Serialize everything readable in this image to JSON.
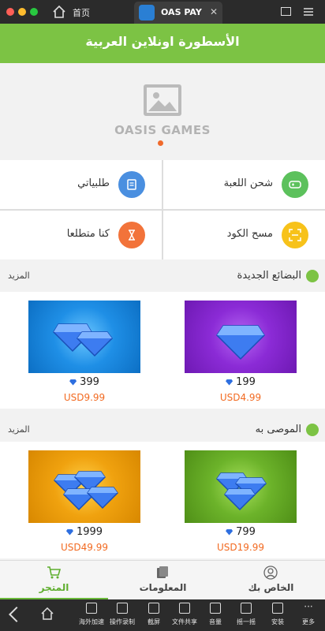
{
  "emulator": {
    "home_tab": "首页",
    "app_tab": "OAS PAY",
    "tools": [
      "海外加速",
      "操作录制",
      "截屏",
      "文件共享",
      "音量",
      "摇一摇",
      "安装",
      "更多"
    ]
  },
  "app": {
    "title": "الأسطورة اونلاين العربية"
  },
  "banner": {
    "logo_text": "OASIS GAMES"
  },
  "menu": [
    {
      "label": "شحن اللعبة",
      "color": "#5cc15c",
      "icon": "gamepad-icon"
    },
    {
      "label": "طلبياتي",
      "color": "#4a8fe0",
      "icon": "orders-icon"
    },
    {
      "label": "مسح الكود",
      "color": "#f7c21a",
      "icon": "scan-icon"
    },
    {
      "label": "كنا متطلعا",
      "color": "#f2733a",
      "icon": "hourglass-icon"
    }
  ],
  "sections": [
    {
      "title": "البضائع الجديدة",
      "more": "المزيد",
      "products": [
        {
          "gems": "199",
          "price": "USD4.99",
          "bg": "#8b2bd6"
        },
        {
          "gems": "399",
          "price": "USD9.99",
          "bg": "#1f8fe6"
        }
      ]
    },
    {
      "title": "الموصى به",
      "more": "المزيد",
      "products": [
        {
          "gems": "799",
          "price": "USD19.99",
          "bg": "#6cb32a"
        },
        {
          "gems": "1999",
          "price": "USD49.99",
          "bg": "#f0a20f"
        }
      ]
    }
  ],
  "bottom_nav": [
    {
      "label": "الخاص بك",
      "icon": "user-icon",
      "active": false
    },
    {
      "label": "المعلومات",
      "icon": "info-icon",
      "active": false
    },
    {
      "label": "المتجر",
      "icon": "cart-icon",
      "active": true
    }
  ],
  "colors": {
    "brand_green": "#7cc344",
    "price_orange": "#f26a21"
  }
}
